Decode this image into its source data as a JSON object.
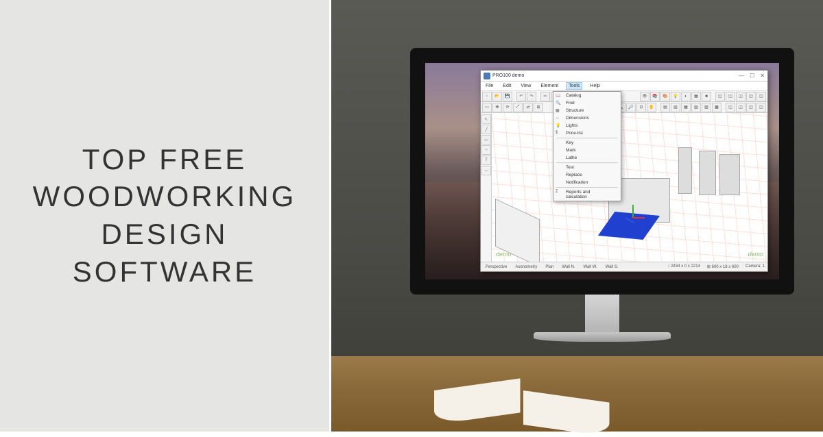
{
  "headline": "TOP FREE\nWOODWORKING\nDESIGN\nSOFTWARE",
  "app": {
    "title": "PRO100 demo",
    "window_controls": {
      "min": "—",
      "max": "☐",
      "close": "✕"
    },
    "menu": [
      "File",
      "Edit",
      "View",
      "Element",
      "Tools",
      "Help"
    ],
    "active_menu": "Tools",
    "dropdown": [
      {
        "icon": "📖",
        "label": "Catalog"
      },
      {
        "icon": "🔍",
        "label": "Find"
      },
      {
        "icon": "▦",
        "label": "Structure"
      },
      {
        "icon": "↔",
        "label": "Dimensions"
      },
      {
        "icon": "💡",
        "label": "Lights"
      },
      {
        "icon": "$",
        "label": "Price-list"
      },
      {
        "sep": true
      },
      {
        "label": "Key"
      },
      {
        "label": "Mark"
      },
      {
        "label": "Lathe"
      },
      {
        "sep": true
      },
      {
        "label": "Test"
      },
      {
        "label": "Replace"
      },
      {
        "label": "Notification"
      },
      {
        "sep": true
      },
      {
        "icon": "Σ",
        "label": "Reports and calculation"
      }
    ],
    "watermark": "demo",
    "status": {
      "tabs": [
        "Perspective",
        "Axonometry",
        "Plan",
        "Wall N.",
        "Wall W.",
        "Wall S."
      ],
      "coords": "↕ 2434 x 0 x 2214",
      "dims": "⊞ 600 x 18 x 600",
      "camera": "Camera: 1"
    }
  }
}
